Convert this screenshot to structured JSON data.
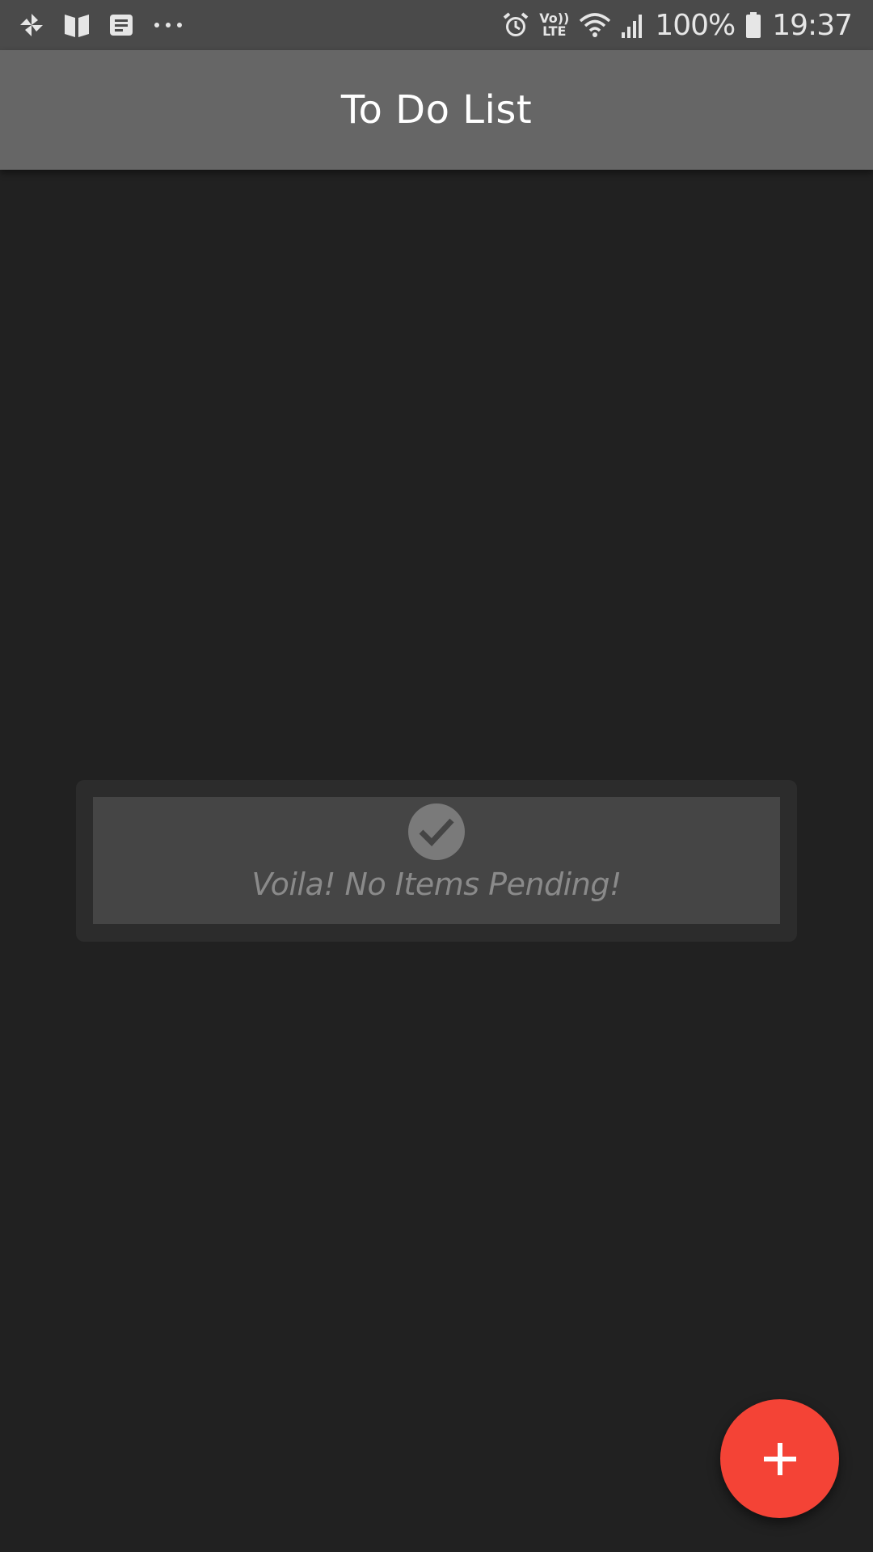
{
  "status_bar": {
    "left_icons": [
      "pinwheel-icon",
      "book-icon",
      "news-icon",
      "more-dots-icon"
    ],
    "right_icons": [
      "alarm-icon",
      "volte-icon",
      "wifi-icon",
      "signal-icon",
      "battery-icon"
    ],
    "volte_top": "Vo))",
    "volte_bottom": "LTE",
    "battery_percent": "100%",
    "time": "19:37"
  },
  "app_bar": {
    "title": "To Do List"
  },
  "empty_state": {
    "icon": "check-circle-icon",
    "message": "Voila! No Items Pending!"
  },
  "fab": {
    "icon": "plus-icon"
  },
  "colors": {
    "background": "#212121",
    "status_bar": "#4a4a4a",
    "app_bar": "#666666",
    "card_outer": "#2c2c2c",
    "card_inner": "#454545",
    "fab": "#f44336"
  }
}
